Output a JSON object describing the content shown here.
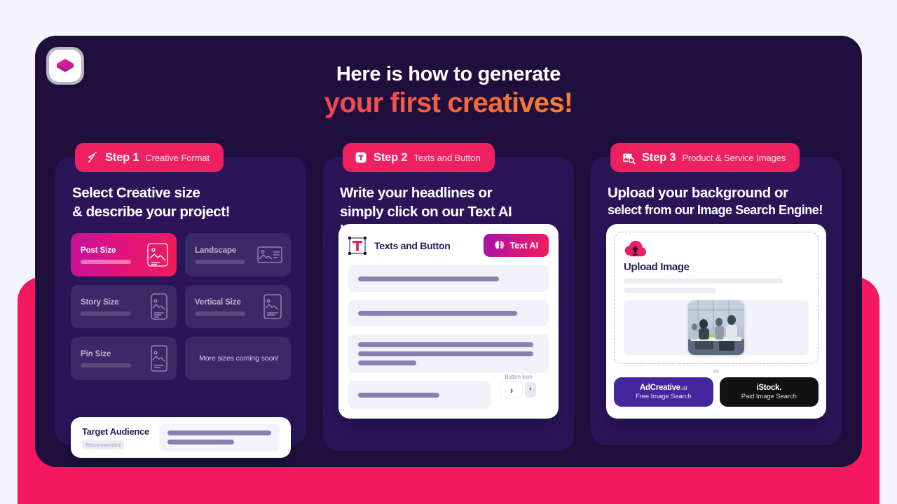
{
  "brand": {
    "logo_icon": "cube-logo-icon"
  },
  "headline": {
    "line1": "Here is how to generate",
    "line2": "your first creatives!",
    "gradient_start": "#ec1082",
    "gradient_end": "#f2c52c"
  },
  "colors": {
    "page_bg": "#f5f4fb",
    "dark_card": "#1e0f3c",
    "panel": "#2a1559",
    "pink_backdrop": "#f31860",
    "badge_pink": "#ee2060",
    "accent_purple": "#45269e"
  },
  "steps": [
    {
      "badge_icon": "rocket-icon",
      "badge_number": "Step 1",
      "badge_subtitle": "Creative Format",
      "title_line1": "Select Creative size",
      "title_line2": "& describe your project!",
      "size_cards": [
        {
          "label": "Post Size",
          "icon": "image-square-icon",
          "selected": true
        },
        {
          "label": "Landscape",
          "icon": "image-landscape-icon",
          "selected": false
        },
        {
          "label": "Story Size",
          "icon": "image-story-icon",
          "selected": false
        },
        {
          "label": "Vertical Size",
          "icon": "image-vertical-icon",
          "selected": false
        },
        {
          "label": "Pin Size",
          "icon": "image-pin-icon",
          "selected": false
        }
      ],
      "coming_soon_label": "More sizes coming soon!",
      "target_audience": {
        "title": "Target Audience",
        "badge": "Recommended",
        "input_placeholder": ""
      }
    },
    {
      "badge_icon": "text-tool-icon",
      "badge_number": "Step 2",
      "badge_subtitle": "Texts and Button",
      "title_line1": "Write your headlines or",
      "title_line2": "simply click on our Text AI button!",
      "card": {
        "icon": "text-tool-selected-icon",
        "title": "Texts and Button",
        "ai_button_label": "Text AI",
        "ai_button_icon": "brain-icon",
        "button_icon_label": "Button Icon",
        "button_icon_glyph": "chevron-right-icon",
        "dropdown_icon": "chevron-down-icon"
      }
    },
    {
      "badge_icon": "image-search-icon",
      "badge_number": "Step 3",
      "badge_subtitle": "Product & Service Images",
      "title_line1": "Upload your background or",
      "title_line2": "select from our Image Search Engine!",
      "card": {
        "upload_icon": "cloud-upload-icon",
        "upload_title": "Upload Image",
        "thumbnail_alt": "office-meeting-photo",
        "or_label": "or",
        "sources": [
          {
            "name": "AdCreative",
            "suffix": ".ai",
            "subtitle": "Free Image Search",
            "style": "free"
          },
          {
            "name": "iStock.",
            "suffix": "",
            "subtitle": "Paid Image Search",
            "style": "paid"
          }
        ]
      }
    }
  ]
}
